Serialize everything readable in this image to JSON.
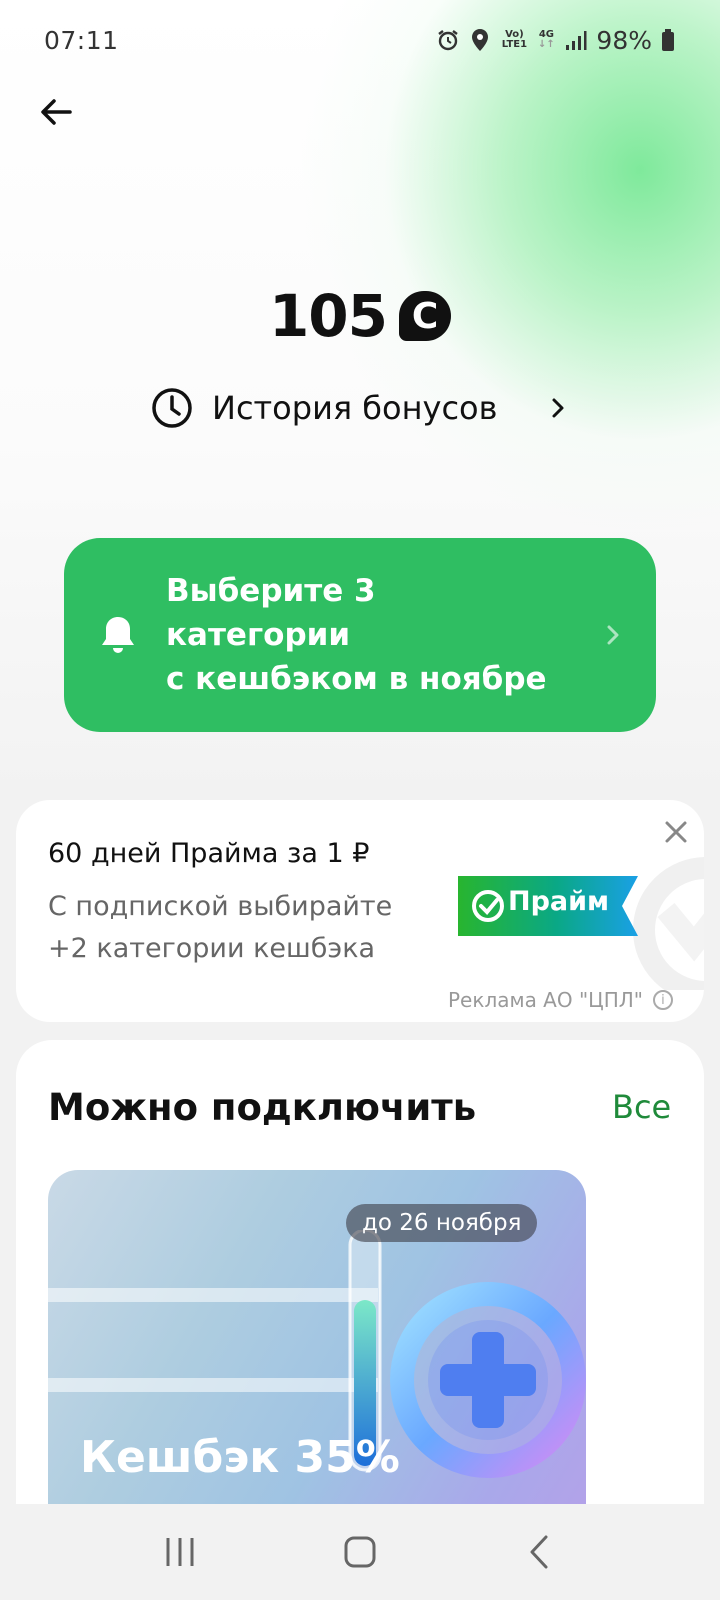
{
  "status_bar": {
    "time": "07:11",
    "network_top": "Vo)",
    "network_bottom": "LTE1",
    "signal_type": "4G",
    "battery_percent": "98%",
    "icons": [
      "alarm-icon",
      "location-icon",
      "volte-icon",
      "4g-icon",
      "signal-icon",
      "battery-icon"
    ]
  },
  "header": {
    "back_icon": "arrow-left-icon"
  },
  "balance": {
    "value": "105",
    "currency_symbol": "С"
  },
  "history": {
    "label": "История бонусов"
  },
  "promo": {
    "text": "Выберите 3\nкатегории\nс кешбэком в ноябре",
    "color": "#2fbe62"
  },
  "ad": {
    "title": "60 дней Прайма за 1 ₽",
    "description": "С подпиской выбирайте\n+2 категории кешбэка",
    "badge_label": "Прайм",
    "disclaimer": "Реклама АО \"ЦПЛ\""
  },
  "connect": {
    "title": "Можно подключить",
    "all_label": "Все",
    "accent": "#1f8a3a",
    "offers": [
      {
        "date": "до 26 ноября",
        "title": "Кешбэк 35%"
      }
    ]
  },
  "nav": {
    "items": [
      "recent-apps-icon",
      "home-icon",
      "back-icon"
    ]
  }
}
